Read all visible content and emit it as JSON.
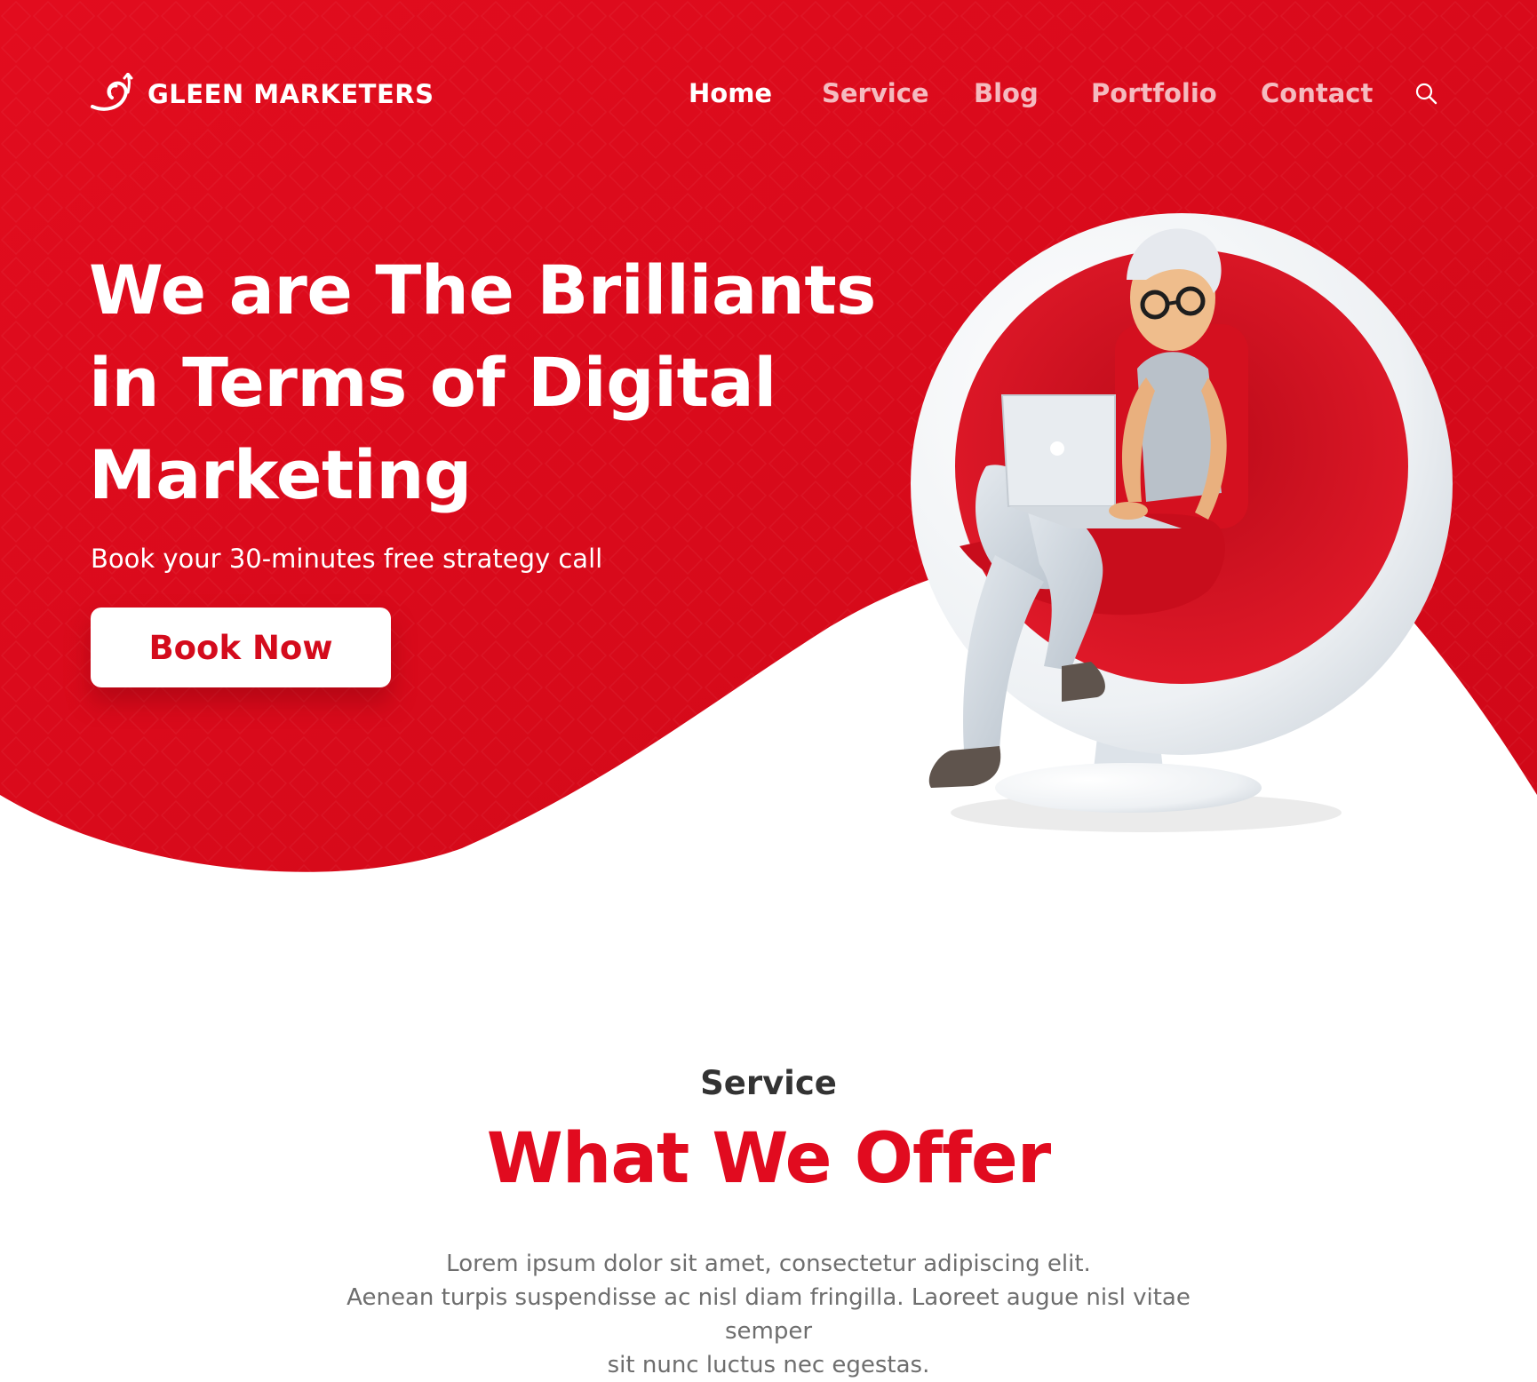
{
  "brand": {
    "name": "GLEEN MARKETERS",
    "logo_icon": "swirl-logo-icon"
  },
  "nav": {
    "items": [
      {
        "label": "Home",
        "active": true
      },
      {
        "label": "Service",
        "active": false
      },
      {
        "label": "Blog",
        "active": false
      },
      {
        "label": "Portfolio",
        "active": false
      },
      {
        "label": "Contact",
        "active": false
      }
    ],
    "search_icon": "search-icon"
  },
  "hero": {
    "title": "We are The Brilliants in Terms of Digital Marketing",
    "subtitle": "Book your 30-minutes free strategy call",
    "cta_label": "Book Now",
    "illustration": "woman-in-egg-chair-with-laptop"
  },
  "services": {
    "eyebrow": "Service",
    "title": "What We Offer",
    "description_lines": [
      "Lorem ipsum dolor sit amet, consectetur adipiscing elit.",
      "Aenean turpis suspendisse ac nisl diam fringilla. Laoreet augue nisl vitae semper",
      "sit nunc luctus nec egestas."
    ]
  },
  "colors": {
    "primary_red": "#e10b1f",
    "dark_red": "#c8091a",
    "white": "#ffffff",
    "text_dark": "#333333",
    "text_gray": "#6e6e6e"
  }
}
